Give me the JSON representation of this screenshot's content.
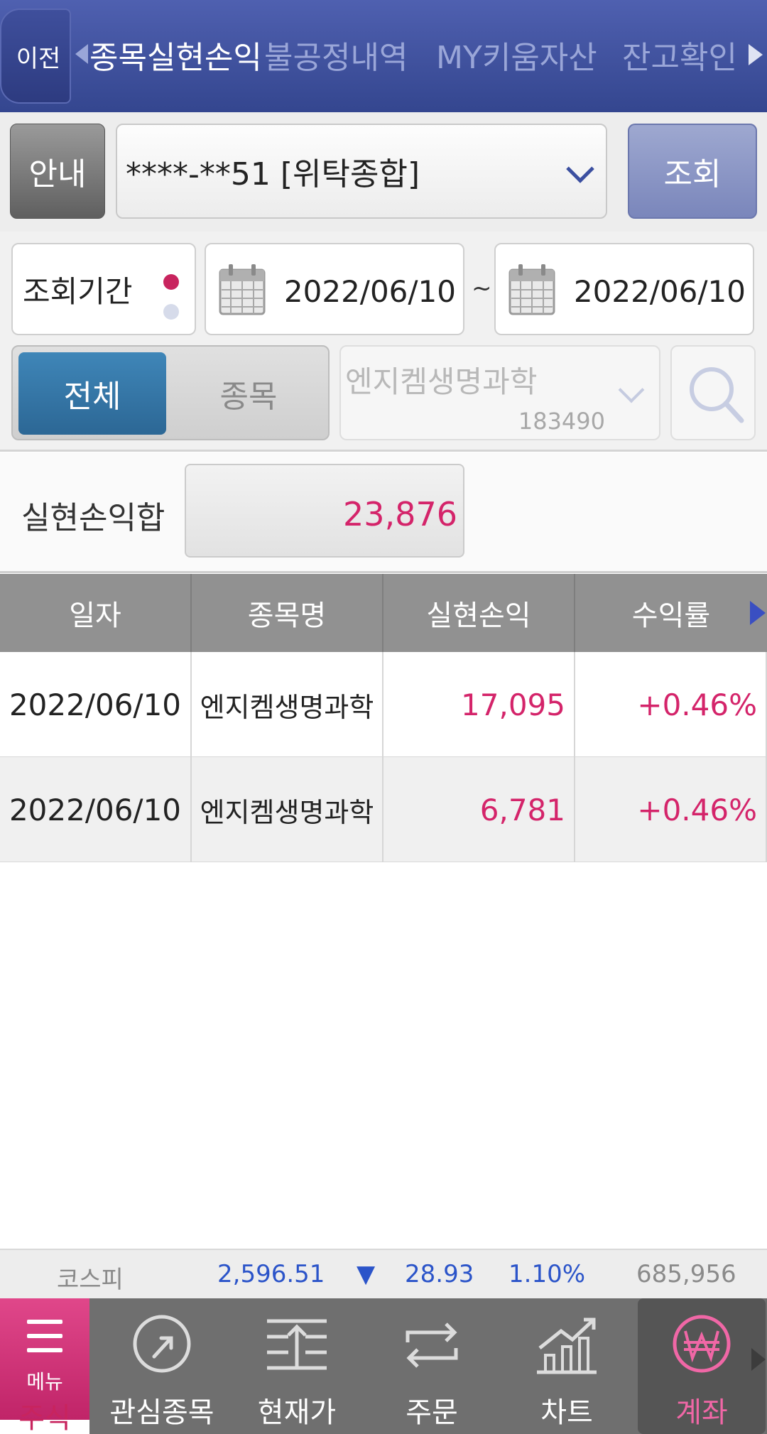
{
  "topbar": {
    "back_label": "이전",
    "tabs": [
      {
        "label": "종목실현손익"
      },
      {
        "label": "불공정내역"
      },
      {
        "label": "MY키움자산"
      },
      {
        "label": "잔고확인"
      }
    ]
  },
  "account": {
    "info_button": "안내",
    "selected_account": "****-**51 [위탁종합]",
    "query_button": "조회"
  },
  "period": {
    "label": "조회기간",
    "start_date": "2022/06/10",
    "separator": "~",
    "end_date": "2022/06/10"
  },
  "filter": {
    "segments": [
      {
        "label": "전체",
        "selected": true
      },
      {
        "label": "종목",
        "selected": false
      }
    ],
    "stock_name": "엔지켐생명과학",
    "stock_code": "183490"
  },
  "summary": {
    "label": "실현손익합",
    "value": "23,876"
  },
  "table": {
    "headers": [
      "일자",
      "종목명",
      "실현손익",
      "수익률"
    ],
    "rows": [
      {
        "date": "2022/06/10",
        "name": "엔지켐생명과학",
        "profit": "17,095",
        "rate": "+0.46%"
      },
      {
        "date": "2022/06/10",
        "name": "엔지켐생명과학",
        "profit": "6,781",
        "rate": "+0.46%"
      }
    ]
  },
  "market": {
    "index_name": "코스피",
    "index_value": "2,596.51",
    "direction": "▼",
    "change": "28.93",
    "change_pct": "1.10%",
    "volume": "685,956"
  },
  "bottomnav": {
    "menu_label": "메뉴",
    "section_label": "주식",
    "items": [
      {
        "label": "관심종목",
        "icon": "watchlist-icon"
      },
      {
        "label": "현재가",
        "icon": "current-price-icon"
      },
      {
        "label": "주문",
        "icon": "order-icon"
      },
      {
        "label": "차트",
        "icon": "chart-icon"
      },
      {
        "label": "계좌",
        "icon": "won-icon",
        "active": true
      }
    ]
  },
  "colors": {
    "header_blue": "#3d4f9c",
    "profit_red": "#d4246a",
    "index_blue": "#2b54c9",
    "menu_pink": "#d0317a"
  }
}
